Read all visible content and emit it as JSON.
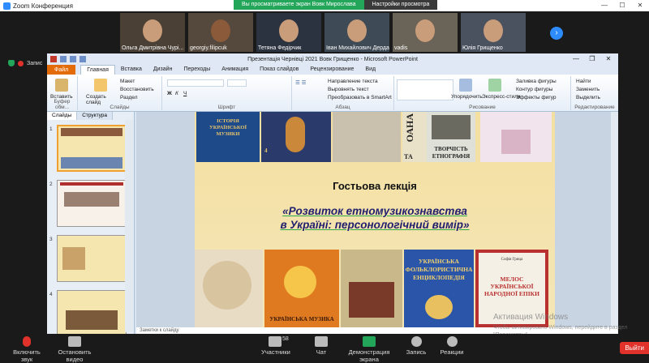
{
  "zoom": {
    "window_title": "Zoom Конференция",
    "share_banner": "Вы просматриваете экран Вовк Мирослава",
    "view_options": "Настройки просмотра",
    "recording": "Запис",
    "participants_count": "58",
    "participants": [
      {
        "name": "Ольга Дмитрівна Чурі..."
      },
      {
        "name": "georgiy.filipcuk"
      },
      {
        "name": "Тетяна Федірчик"
      },
      {
        "name": "Іван Михайлович Дерда"
      },
      {
        "name": "vadis"
      },
      {
        "name": "Юлія Грищенко"
      }
    ],
    "toolbar": {
      "mute": "Включить звук",
      "video": "Остановить видео",
      "participants": "Участники",
      "chat": "Чат",
      "share": "Демонстрация экрана",
      "record": "Запись",
      "reactions": "Реакции",
      "end": "Выйти"
    }
  },
  "ppt": {
    "title": "Презентація Чернівці 2021 Вовк Грищенко - Microsoft PowerPoint",
    "tabs": [
      "Файл",
      "Главная",
      "Вставка",
      "Дизайн",
      "Переходы",
      "Анимация",
      "Показ слайдов",
      "Рецензирование",
      "Вид"
    ],
    "active_tab": "Главная",
    "ribbon": {
      "paste": "Вставить",
      "clipboard": "Буфер обм...",
      "create_slide": "Создать слайд",
      "layout": "Макет",
      "reset": "Восстановить",
      "section": "Раздел",
      "slides_group": "Слайды",
      "font_group": "Шрифт",
      "text_direction": "Направление текста",
      "align_text": "Выровнять текст",
      "smartart": "Преобразовать в SmartArt",
      "paragraph_group": "Абзац",
      "arrange": "Упорядочить",
      "quick_styles": "Экспресс-стили",
      "shape_fill": "Заливка фигуры",
      "shape_outline": "Контур фигуры",
      "shape_effects": "Эффекты фигур",
      "drawing_group": "Рисование",
      "find": "Найти",
      "replace": "Заменить",
      "select": "Выделить",
      "editing_group": "Редактирование"
    },
    "panel_tabs": [
      "Слайды",
      "Структура"
    ],
    "slide_numbers": [
      "1",
      "2",
      "3",
      "4"
    ],
    "notes_placeholder": "Заметки к слайду",
    "slide": {
      "title": "Гостьова лекція",
      "subtitle_line1": "«Розвиток етномузикознавства",
      "subtitle_line2": "в Україні: персонологічний вимір»",
      "book_top_1_a": "ІСТОРІЯ",
      "book_top_1_b": "УКРАЇНСЬКОЇ",
      "book_top_1_c": "МУЗИКИ",
      "book_top_1_num": "4",
      "book_top_3": "ТВОРЧІСТЬ",
      "book_top_3b": "ЕТНОГРАФІЯ",
      "book_top_3_prefix": "ТА",
      "book_top_3_vert": "ОАНА",
      "book_bottom_4a": "УКРАЇНСЬКА",
      "book_bottom_4b": "ФОЛЬКЛОРИСТИЧНА",
      "book_bottom_4c": "ЕНЦИКЛОПЕДІЯ",
      "book_bottom_5_author": "Софія Грица",
      "book_bottom_5a": "МЕЛОС",
      "book_bottom_5b": "УКРАЇНСЬКОЇ",
      "book_bottom_5c": "НАРОДНОЇ ЕПІКИ",
      "book_bottom_2": "УКРАЇНСЬКА МУЗИКА"
    },
    "watermark_1": "Активация Windows",
    "watermark_2": "Чтобы активировать Windows, перейдите в раздел \"Параметры\"."
  },
  "colors": {
    "zoom_blue": "#2d8cff",
    "banner_green": "#23a55a",
    "file_tab_orange": "#e36c09",
    "end_red": "#e0312b"
  }
}
